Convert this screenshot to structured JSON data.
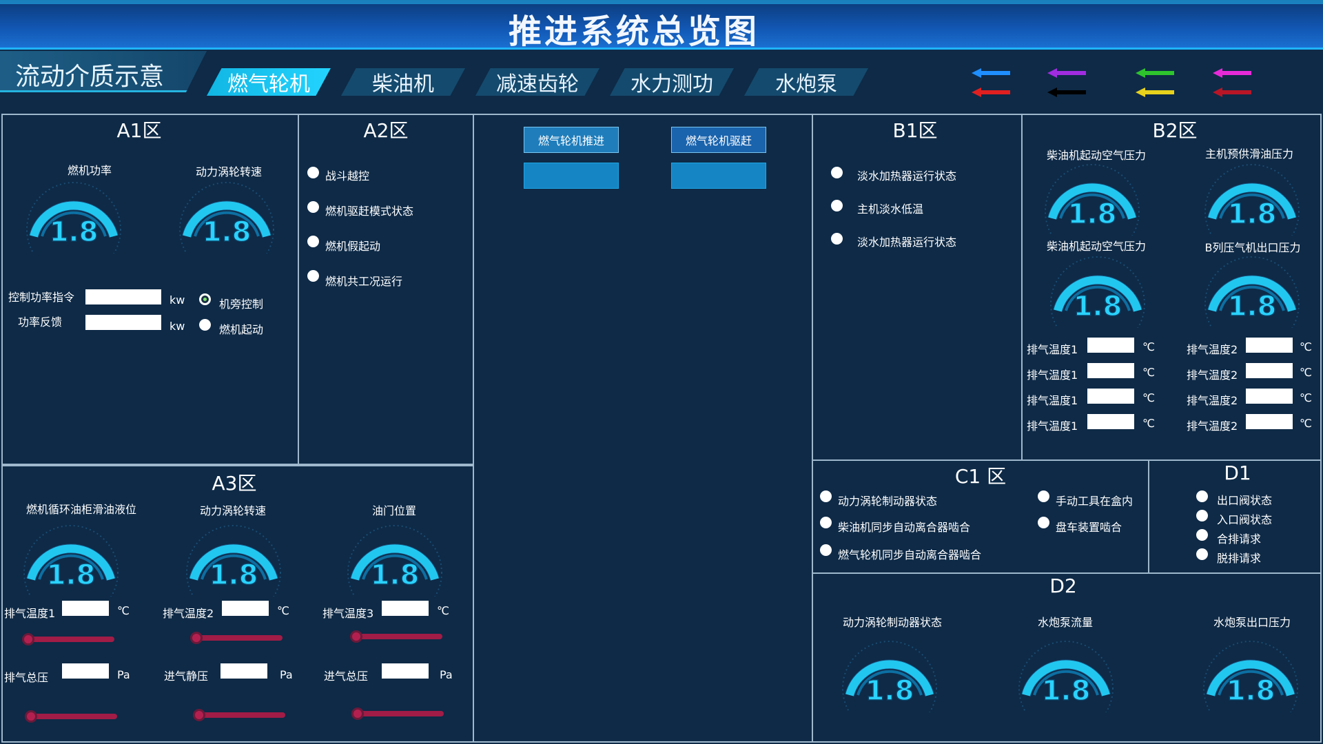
{
  "title": "推进系统总览图",
  "subtitle": "流动介质示意",
  "tabs": [
    "燃气轮机",
    "柴油机",
    "减速齿轮",
    "水力测功",
    "水炮泵"
  ],
  "arrows": [
    {
      "color": "#1f8fff"
    },
    {
      "color": "#a02ce0"
    },
    {
      "color": "#2ec42e"
    },
    {
      "color": "#e62ad8"
    },
    {
      "color": "#e02020"
    },
    {
      "color": "#000000"
    },
    {
      "color": "#e8d21c"
    },
    {
      "color": "#b81626"
    }
  ],
  "gauge_value": "1.8",
  "a1": {
    "title": "A1区",
    "g1": "燃机功率",
    "g2": "动力涡轮转速",
    "f1": "控制功率指令",
    "f2": "功率反馈",
    "unit": "kw",
    "r1": "机旁控制",
    "r2": "燃机起动"
  },
  "a2": {
    "title": "A2区",
    "items": [
      "战斗越控",
      "燃机驱赶模式状态",
      "燃机假起动",
      "燃机共工况运行"
    ]
  },
  "center": {
    "btn1": "燃气轮机推进",
    "btn2": "燃气轮机驱赶"
  },
  "a3": {
    "title": "A3区",
    "g1": "燃机循环油柜滑油液位",
    "g2": "动力涡轮转速",
    "g3": "油门位置",
    "t1": "排气温度1",
    "t2": "排气温度2",
    "t3": "排气温度3",
    "tu": "℃",
    "p1": "排气总压",
    "p2": "进气静压",
    "p3": "进气总压",
    "pu": "Pa"
  },
  "b1": {
    "title": "B1区",
    "items": [
      "淡水加热器运行状态",
      "主机淡水低温",
      "淡水加热器运行状态"
    ]
  },
  "b2": {
    "title": "B2区",
    "g1": "柴油机起动空气压力",
    "g2": "主机预供滑油压力",
    "g3": "柴油机起动空气压力",
    "g4": "B列压气机出口压力",
    "t1": "排气温度1",
    "t2": "排气温度2",
    "unit": "℃"
  },
  "c1": {
    "title": "C1 区",
    "left": [
      "动力涡轮制动器状态",
      "柴油机同步自动离合器啮合",
      "燃气轮机同步自动离合器啮合"
    ],
    "right": [
      "手动工具在盒内",
      "盘车装置啮合"
    ]
  },
  "d1": {
    "title": "D1",
    "items": [
      "出口阀状态",
      "入口阀状态",
      "合排请求",
      "脱排请求"
    ]
  },
  "d2": {
    "title": "D2",
    "g1": "动力涡轮制动器状态",
    "g2": "水炮泵流量",
    "g3": "水炮泵出口压力"
  }
}
